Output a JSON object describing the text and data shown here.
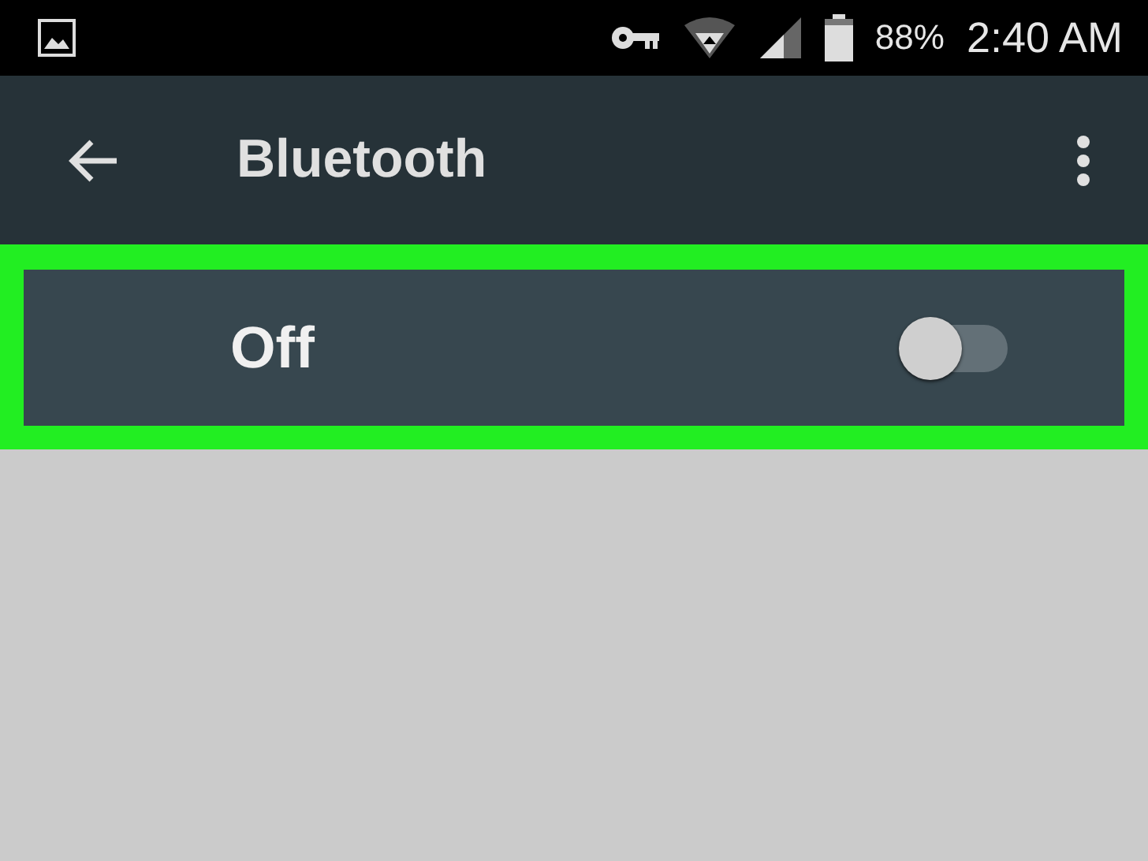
{
  "status_bar": {
    "battery": "88%",
    "time": "2:40 AM"
  },
  "toolbar": {
    "title": "Bluetooth"
  },
  "bluetooth_row": {
    "label": "Off",
    "on": false
  }
}
